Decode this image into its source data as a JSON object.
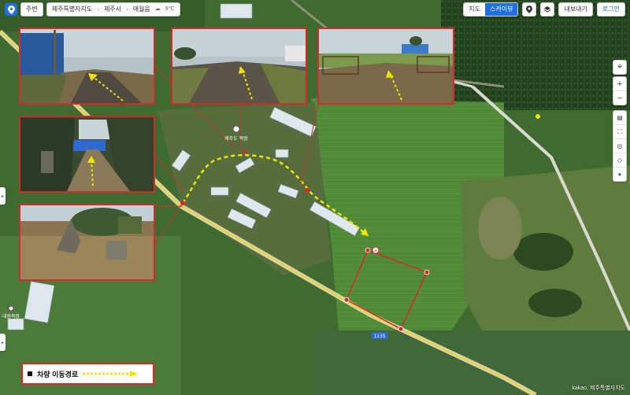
{
  "top_left": {
    "home_label": "주변",
    "breadcrumb": [
      "제주특별자치도",
      "제주시",
      "애월읍"
    ],
    "weather": "9℃"
  },
  "top_right": {
    "view_options": [
      "지도",
      "스카이뷰"
    ],
    "active_view": "스카이뷰",
    "export_label": "내보내기",
    "login_label": "로그인"
  },
  "map_labels": {
    "road_number": "1135",
    "place_label": "대원목장",
    "poi_label": "제주도 목장"
  },
  "legend": {
    "label": "차량 이동경로"
  },
  "attribution": "kakao, 제주특별자치도",
  "colors": {
    "accent_blue": "#1f6fe0",
    "route_yellow": "#f2e400",
    "boundary_red": "#d42a2a"
  }
}
